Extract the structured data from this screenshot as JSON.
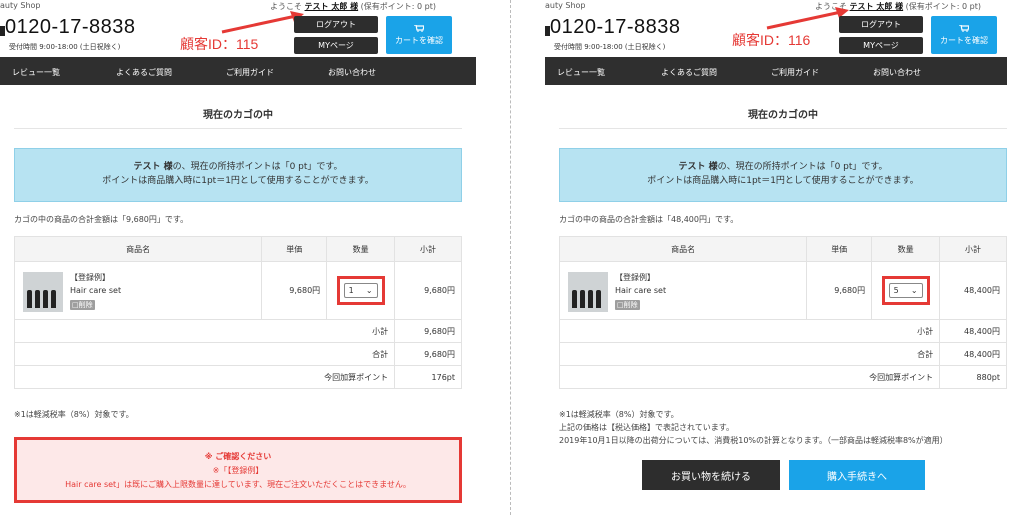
{
  "header": {
    "shop_name": "auty Shop",
    "welcome_prefix": "ようこそ",
    "user_name": "テスト 太郎 様",
    "points_suffix": "(保有ポイント: 0 pt)",
    "phone": "0120-17-8838",
    "hours": "受付時間 9:00-18:00 (土日祝除く)",
    "logout_label": "ログアウト",
    "mypage_label": "MYページ",
    "cart_label": "カートを確認"
  },
  "nav": [
    "レビュー一覧",
    "よくあるご質問",
    "ご利用ガイド",
    "お問い合わせ"
  ],
  "cart": {
    "title": "現在のカゴの中",
    "info_name": "テスト 様",
    "info_line1_rest": "の、現在の所持ポイントは「0 pt」です。",
    "info_line2": "ポイントは商品購入時に1pt＝1円として使用することができます。",
    "columns": [
      "商品名",
      "単価",
      "数量",
      "小計"
    ],
    "product_tag": "【登録例】",
    "product_name": "Hair care set",
    "delete_label": "削除",
    "unit_price": "9,680円",
    "subtotal_label": "小計",
    "total_label": "合計",
    "points_label": "今回加算ポイント",
    "tax_note": "※1は軽減税率（8%）対象です。"
  },
  "left": {
    "customer_id": "顧客ID：115",
    "summary": "カゴの中の商品の合計金額は「9,680円」です。",
    "quantity": "1",
    "line_subtotal": "9,680円",
    "subtotal": "9,680円",
    "total": "9,680円",
    "points": "176pt",
    "alert_title": "※ ご確認ください",
    "alert_line2": "※「【登録例】",
    "alert_line3": "Hair care set」は既にご購入上限数量に達しています、現在ご注文いただくことはできません。"
  },
  "right": {
    "customer_id": "顧客ID：116",
    "summary": "カゴの中の商品の合計金額は「48,400円」です。",
    "quantity": "5",
    "line_subtotal": "48,400円",
    "subtotal": "48,400円",
    "total": "48,400円",
    "points": "880pt",
    "note2": "上記の価格は【税込価格】で表記されています。",
    "note3": "2019年10月1日以降の出荷分については、消費税10%の計算となります。（一部商品は軽減税率8%が適用）",
    "continue_label": "お買い物を続ける",
    "checkout_label": "購入手続きへ"
  },
  "colors": {
    "accent_red": "#e53935",
    "brand_blue": "#1aa3e8",
    "nav_dark": "#2f2f2f",
    "info_bg": "#b7e3f2"
  }
}
